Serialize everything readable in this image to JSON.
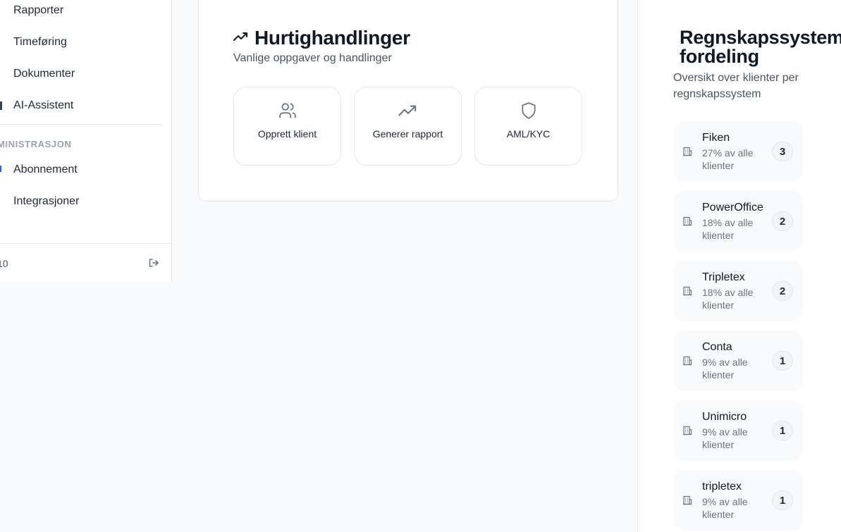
{
  "sidebar": {
    "items": [
      {
        "label": "Rapporter"
      },
      {
        "label": "Timeføring"
      },
      {
        "label": "Dokumenter"
      },
      {
        "label": "AI-Assistent"
      }
    ],
    "section_label": "DMINISTRASJON",
    "admin_items": [
      {
        "label": "Abonnement"
      },
      {
        "label": "Integrasjoner"
      }
    ],
    "footer_text": "10"
  },
  "quick_actions": {
    "title": "Hurtighandlinger",
    "subtitle": "Vanlige oppgaver og handlinger",
    "actions": [
      {
        "label": "Opprett klient",
        "icon": "users-icon"
      },
      {
        "label": "Generer rapport",
        "icon": "trending-up-icon"
      },
      {
        "label": "AML/KYC",
        "icon": "shield-icon"
      }
    ]
  },
  "distribution": {
    "title": "Regnskapssystem fordeling",
    "subtitle": "Oversikt over klienter per regnskapssystem",
    "systems": [
      {
        "name": "Fiken",
        "share": "27% av alle klienter",
        "count": "3"
      },
      {
        "name": "PowerOffice",
        "share": "18% av alle klienter",
        "count": "2"
      },
      {
        "name": "Tripletex",
        "share": "18% av alle klienter",
        "count": "2"
      },
      {
        "name": "Conta",
        "share": "9% av alle klienter",
        "count": "1"
      },
      {
        "name": "Unimicro",
        "share": "9% av alle klienter",
        "count": "1"
      },
      {
        "name": "tripletex",
        "share": "9% av alle klienter",
        "count": "1"
      }
    ]
  },
  "colors": {
    "text_primary": "#111827",
    "text_muted": "#6b7280",
    "border": "#e5e7eb"
  }
}
